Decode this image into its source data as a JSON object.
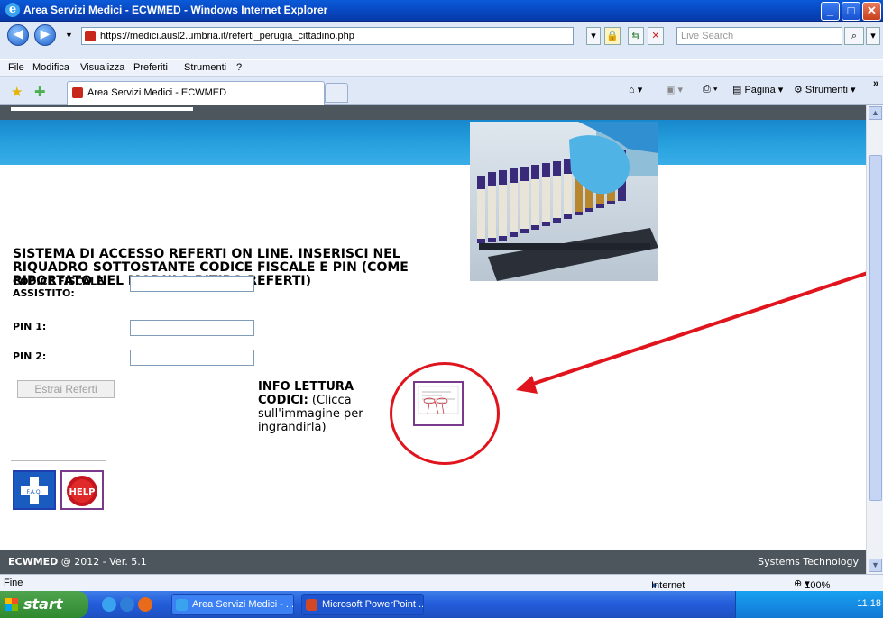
{
  "window": {
    "title": "Area Servizi Medici - ECWMED - Windows Internet Explorer",
    "min_glyph": "_",
    "max_glyph": "□",
    "close_glyph": "✕"
  },
  "browser": {
    "back_glyph": "◀",
    "forward_glyph": "▶",
    "url": "https://medici.ausl2.umbria.it/referti_perugia_cittadino.php",
    "search_placeholder": "Live Search",
    "menu": [
      "File",
      "Modifica",
      "Visualizza",
      "Preferiti",
      "Strumenti",
      "?"
    ],
    "tab_title": "Area Servizi Medici - ECWMED",
    "cmd_pagina": "Pagina",
    "cmd_strumenti": "Strumenti",
    "chevron": "»"
  },
  "page": {
    "heading": "SISTEMA DI ACCESSO REFERTI ON LINE. INSERISCI NEL RIQUADRO SOTTOSTANTE CODICE FISCALE E PIN (COME RIPORTATO NEL MODULO RITIRO REFERTI)",
    "codice_fiscale_label": "CODICE FISCALE ASSISTITO:",
    "codice_fiscale_value": "",
    "pin1_label": "PIN 1:",
    "pin1_value": "",
    "pin2_label": "PIN 2:",
    "pin2_value": "",
    "submit_label": "Estrai Referti",
    "info_bold": "INFO LETTURA CODICI:",
    "info_rest": " (Clicca sull'immagine per ingrandirla)",
    "faq_text": "F.A.Q.",
    "help_text": "HELP",
    "footer_left_bold": "ECWMED",
    "footer_left_rest": " @ 2012 - Ver. 5.1",
    "footer_right": "Systems Technology",
    "annotation_color": "#e0141c"
  },
  "statusbar": {
    "text": "Fine",
    "zone": "Internet",
    "zoom": "100%"
  },
  "taskbar": {
    "start_label": "start",
    "items": [
      "Area Servizi Medici - ...",
      "Microsoft PowerPoint ..."
    ],
    "clock": "11.18"
  }
}
